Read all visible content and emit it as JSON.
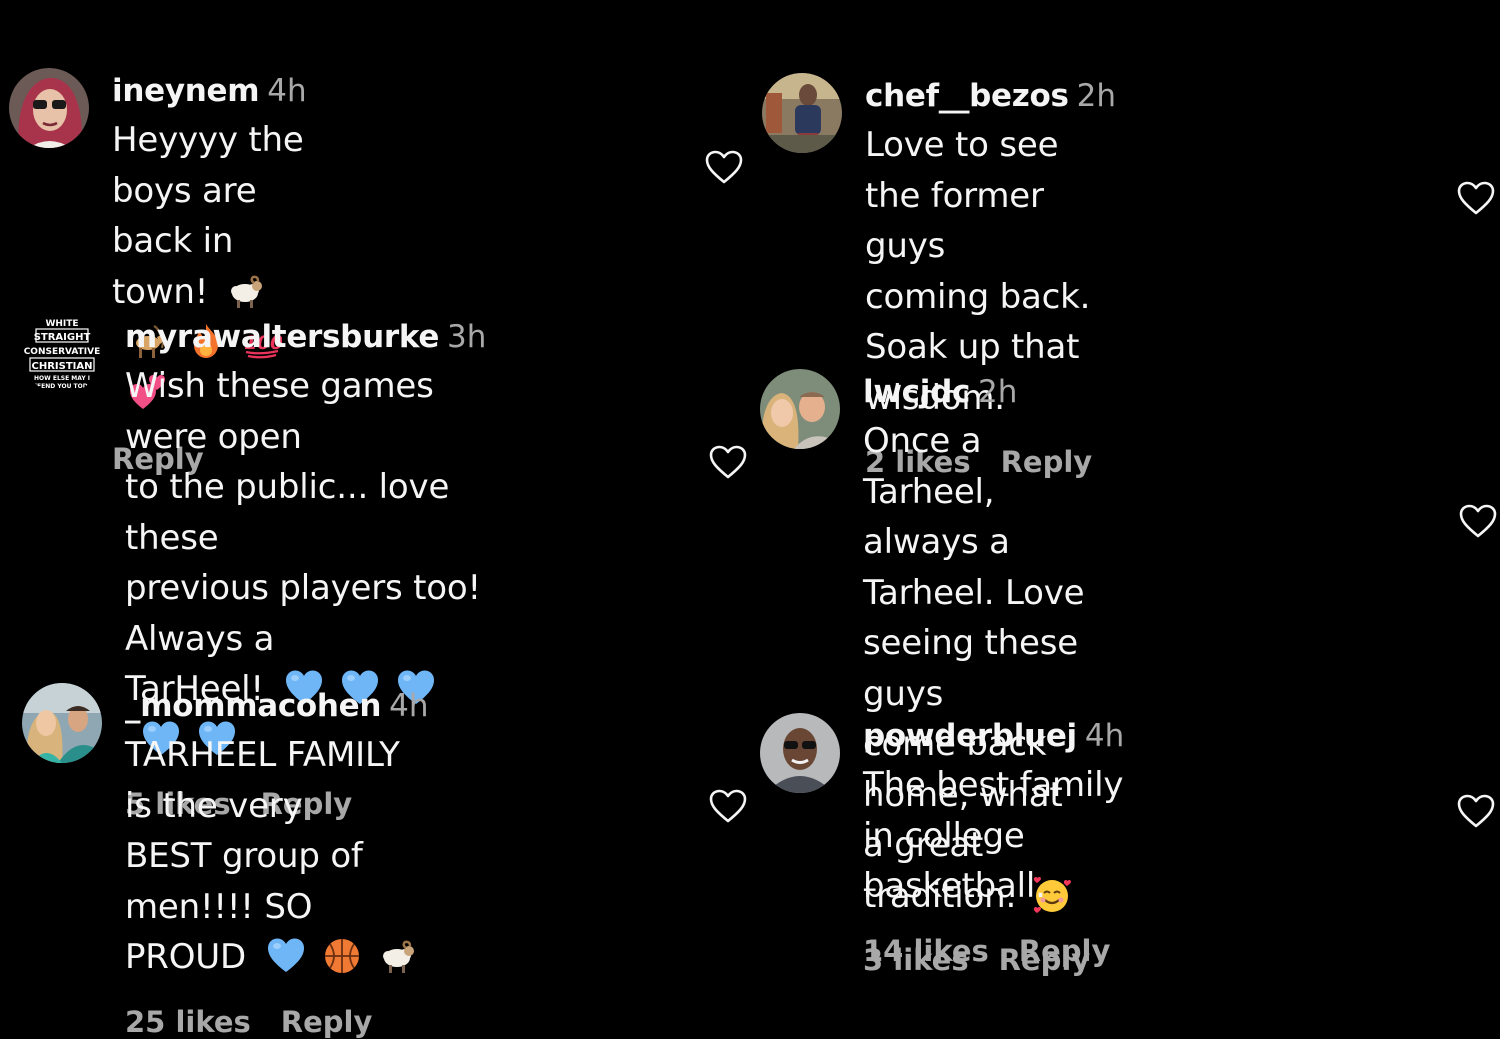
{
  "icons": {
    "like": "heart-outline-icon",
    "emoji_ram": "ram-emoji",
    "emoji_goat": "goat-emoji",
    "emoji_fire": "fire-emoji",
    "emoji_hundred": "hundred-points-emoji",
    "emoji_two_hearts": "two-hearts-emoji",
    "emoji_light_blue_heart": "light-blue-heart-emoji",
    "emoji_basketball": "basketball-emoji",
    "emoji_smiling_hearts": "smiling-face-with-hearts-emoji"
  },
  "colors": {
    "background": "#000000",
    "text": "#f5f5f5",
    "secondary": "#a8a8a8",
    "light_blue_heart": "#74b8ff"
  },
  "comments": [
    {
      "username": "ineynem",
      "time": "4h",
      "lines": [
        "Heyyyy the boys are back in",
        "town!"
      ],
      "likes": "",
      "reply": "Reply"
    },
    {
      "username": "myrawaltersburke",
      "time": "3h",
      "avatar_text": [
        "WHITE",
        "STRAIGHT",
        "CONSERVATIVE",
        "CHRISTIAN",
        "HOW ELSE MAY I",
        "OFFEND YOU TODAY"
      ],
      "lines": [
        "Wish these games were open",
        "to the public... love these",
        "previous players too! Always a",
        "TarHeel!"
      ],
      "likes": "5 likes",
      "reply": "Reply"
    },
    {
      "username": "_mommacohen",
      "time": "4h",
      "lines": [
        "TARHEEL FAMILY is the very",
        "BEST group of men!!!! SO",
        "PROUD"
      ],
      "likes": "25 likes",
      "reply": "Reply"
    },
    {
      "username": "chef__bezos",
      "time": "2h",
      "lines": [
        "Love to see the former guys",
        "coming back. Soak up that",
        "wisdom."
      ],
      "likes": "2 likes",
      "reply": "Reply"
    },
    {
      "username": "lwcjdc",
      "time": "2h",
      "lines": [
        "Once a Tarheel, always a",
        "Tarheel. Love seeing these guys",
        "come back home, what a great",
        "tradition."
      ],
      "likes": "3 likes",
      "reply": "Reply"
    },
    {
      "username": "powderbluej",
      "time": "4h",
      "lines": [
        "The best family in college",
        "basketball."
      ],
      "likes": "14 likes",
      "reply": "Reply"
    }
  ]
}
